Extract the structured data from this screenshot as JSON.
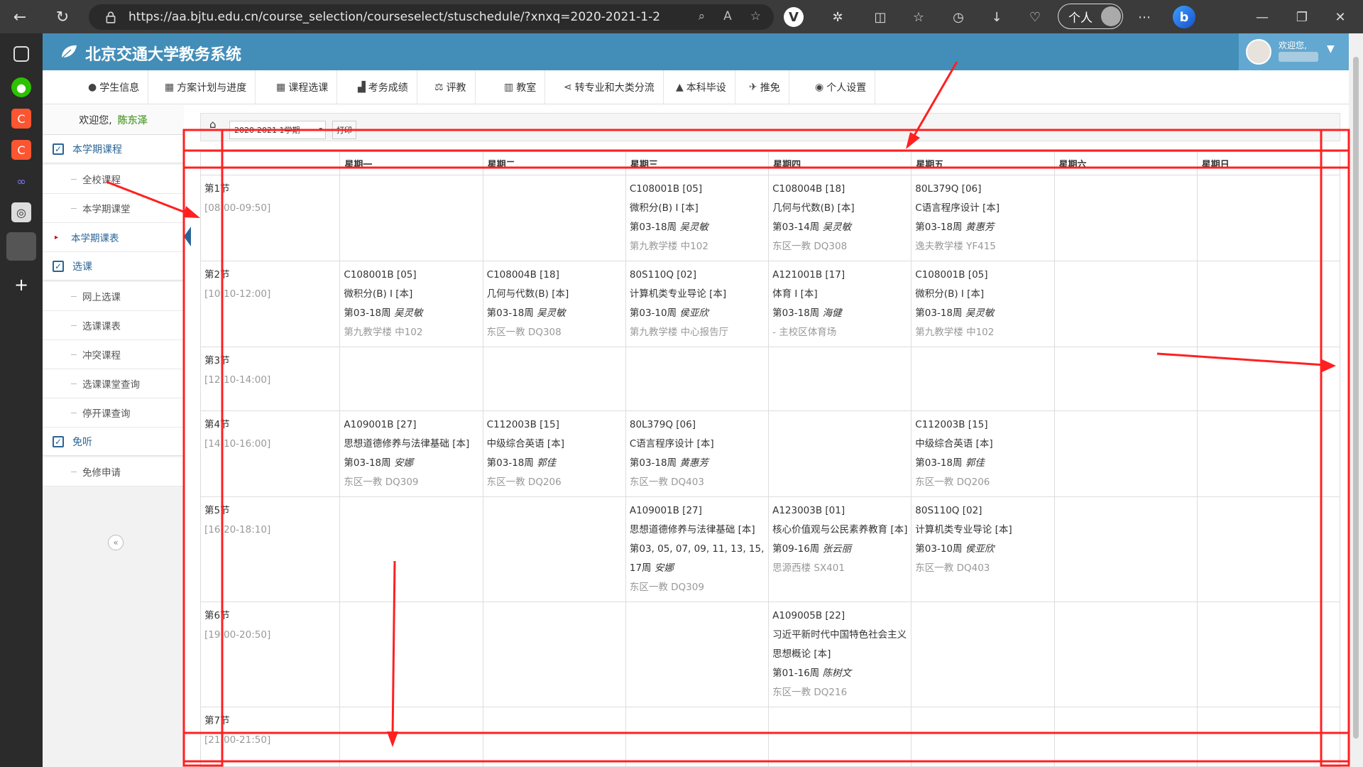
{
  "browser": {
    "url": "https://aa.bjtu.edu.cn/course_selection/courseselect/stuschedule/?xnxq=2020-2021-1-2",
    "profile_label": "个人",
    "bing_label": "b"
  },
  "header": {
    "title": "北京交通大学教务系统",
    "greeting": "欢迎您,"
  },
  "menu": [
    {
      "icon": "info-icon",
      "glyph": "●",
      "label": "学生信息"
    },
    {
      "icon": "calendar-icon",
      "glyph": "▦",
      "label": "方案计划与进度"
    },
    {
      "icon": "calendar-icon",
      "glyph": "▦",
      "label": "课程选课"
    },
    {
      "icon": "chart-icon",
      "glyph": "▟",
      "label": "考务成绩"
    },
    {
      "icon": "scale-icon",
      "glyph": "⚖",
      "label": "评教"
    },
    {
      "icon": "building-icon",
      "glyph": "▥",
      "label": "教室"
    },
    {
      "icon": "share-icon",
      "glyph": "⋖",
      "label": "转专业和大类分流"
    },
    {
      "icon": "graduation-icon",
      "glyph": "▲",
      "label": "本科毕设"
    },
    {
      "icon": "plane-icon",
      "glyph": "✈",
      "label": "推免"
    },
    {
      "icon": "globe-icon",
      "glyph": "◉",
      "label": "个人设置"
    }
  ],
  "sidebar": {
    "welcome_prefix": "欢迎您,",
    "user_name": "陈东泽",
    "groups": [
      {
        "label": "本学期课程",
        "items": [
          "全校课程",
          "本学期课堂",
          "本学期课表"
        ]
      },
      {
        "label": "选课",
        "items": [
          "网上选课",
          "选课课表",
          "冲突课程",
          "选课课堂查询",
          "停开课查询"
        ]
      },
      {
        "label": "免听",
        "items": [
          "免修申请"
        ]
      }
    ],
    "active_item": "本学期课表",
    "collapse_glyph": "«"
  },
  "toolbar": {
    "term": "2020-2021 1学期",
    "print_label": "打印"
  },
  "schedule": {
    "days": [
      "星期一",
      "星期二",
      "星期三",
      "星期四",
      "星期五",
      "星期六",
      "星期日"
    ],
    "slots": [
      {
        "name": "第1节",
        "time": "[08:00-09:50]",
        "cells": [
          null,
          null,
          {
            "code": "C108001B [05]",
            "name": "微积分(B) Ⅰ [本]",
            "week": "第03-18周",
            "teacher": "吴灵敏",
            "room": "第九教学楼 中102"
          },
          {
            "code": "C108004B [18]",
            "name": "几何与代数(B) [本]",
            "week": "第03-14周",
            "teacher": "吴灵敏",
            "room": "东区一教 DQ308"
          },
          {
            "code": "80L379Q [06]",
            "name": "C语言程序设计 [本]",
            "week": "第03-18周",
            "teacher": "黄惠芳",
            "room": "逸夫教学楼 YF415"
          },
          null,
          null
        ]
      },
      {
        "name": "第2节",
        "time": "[10:10-12:00]",
        "cells": [
          {
            "code": "C108001B [05]",
            "name": "微积分(B) Ⅰ [本]",
            "week": "第03-18周",
            "teacher": "吴灵敏",
            "room": "第九教学楼 中102"
          },
          {
            "code": "C108004B [18]",
            "name": "几何与代数(B) [本]",
            "week": "第03-18周",
            "teacher": "吴灵敏",
            "room": "东区一教 DQ308"
          },
          {
            "code": "80S110Q [02]",
            "name": "计算机类专业导论 [本]",
            "week": "第03-10周",
            "teacher": "侯亚欣",
            "room": "第九教学楼 中心报告厅"
          },
          {
            "code": "A121001B [17]",
            "name": "体育 Ⅰ [本]",
            "week": "第03-18周",
            "teacher": "海健",
            "room": "- 主校区体育场"
          },
          {
            "code": "C108001B [05]",
            "name": "微积分(B) Ⅰ [本]",
            "week": "第03-18周",
            "teacher": "吴灵敏",
            "room": "第九教学楼 中102"
          },
          null,
          null
        ]
      },
      {
        "name": "第3节",
        "time": "[12:10-14:00]",
        "cells": [
          null,
          null,
          null,
          null,
          null,
          null,
          null
        ]
      },
      {
        "name": "第4节",
        "time": "[14:10-16:00]",
        "cells": [
          {
            "code": "A109001B [27]",
            "name": "思想道德修养与法律基础 [本]",
            "week": "第03-18周",
            "teacher": "安娜",
            "room": "东区一教 DQ309"
          },
          {
            "code": "C112003B [15]",
            "name": "中级综合英语 [本]",
            "week": "第03-18周",
            "teacher": "郭佳",
            "room": "东区一教 DQ206"
          },
          {
            "code": "80L379Q [06]",
            "name": "C语言程序设计 [本]",
            "week": "第03-18周",
            "teacher": "黄惠芳",
            "room": "东区一教 DQ403"
          },
          null,
          {
            "code": "C112003B [15]",
            "name": "中级综合英语 [本]",
            "week": "第03-18周",
            "teacher": "郭佳",
            "room": "东区一教 DQ206"
          },
          null,
          null
        ]
      },
      {
        "name": "第5节",
        "time": "[16:20-18:10]",
        "cells": [
          null,
          null,
          {
            "code": "A109001B [27]",
            "name": "思想道德修养与法律基础 [本]",
            "week": "第03, 05, 07, 09, 11, 13, 15, 17周",
            "teacher": "安娜",
            "room": "东区一教 DQ309"
          },
          {
            "code": "A123003B [01]",
            "name": "核心价值观与公民素养教育 [本]",
            "week": "第09-16周",
            "teacher": "张云丽",
            "room": "思源西楼 SX401"
          },
          {
            "code": "80S110Q [02]",
            "name": "计算机类专业导论 [本]",
            "week": "第03-10周",
            "teacher": "侯亚欣",
            "room": "东区一教 DQ403"
          },
          null,
          null
        ]
      },
      {
        "name": "第6节",
        "time": "[19:00-20:50]",
        "cells": [
          null,
          null,
          null,
          {
            "code": "A109005B [22]",
            "name": "习近平新时代中国特色社会主义思想概论 [本]",
            "week": "第01-16周",
            "teacher": "陈树文",
            "room": "东区一教 DQ216"
          },
          null,
          null,
          null
        ]
      },
      {
        "name": "第7节",
        "time": "[21:00-21:50]",
        "cells": [
          null,
          null,
          null,
          null,
          null,
          null,
          null
        ]
      }
    ]
  },
  "colors": {
    "header_bg": "#438eb9",
    "annotation_red": "#ff2020",
    "user_green": "#6aa84f"
  }
}
